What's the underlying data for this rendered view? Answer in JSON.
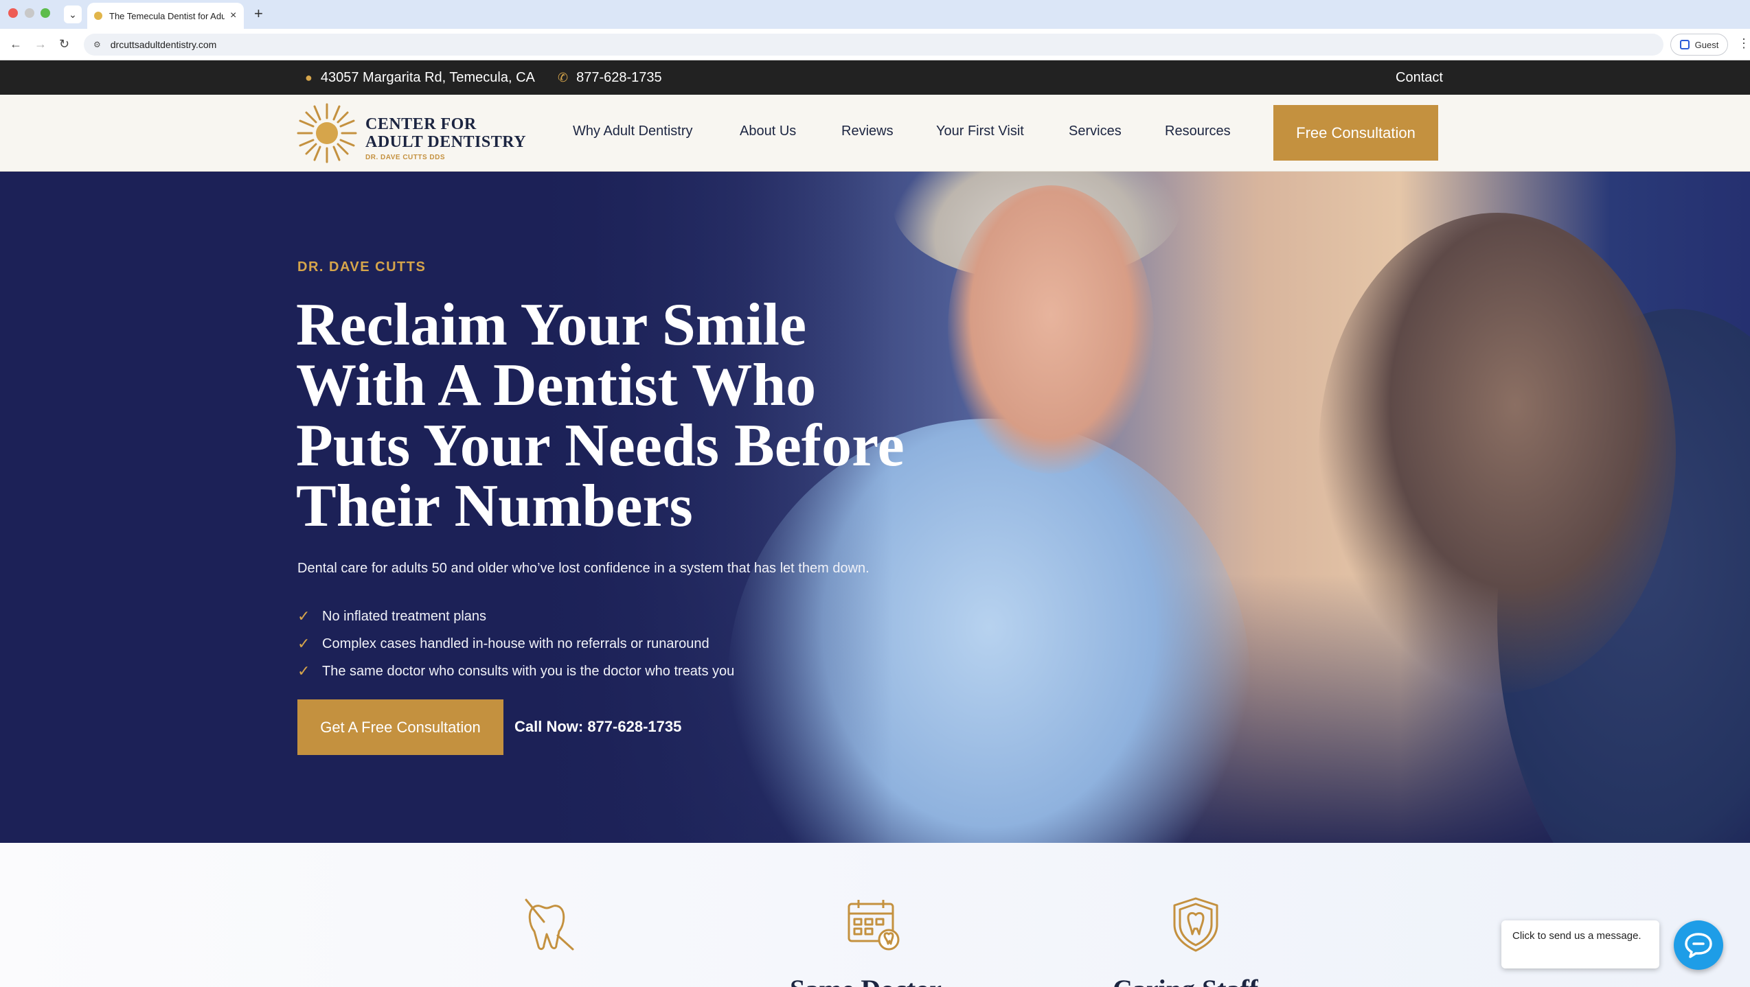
{
  "browser": {
    "tab_title": "The Temecula Dentist for Adu",
    "url": "drcuttsadultdentistry.com",
    "profile_label": "Guest",
    "new_tab": "+",
    "tab_close": "×"
  },
  "topbar": {
    "address": "43057 Margarita Rd, Temecula, CA",
    "phone": "877-628-1735",
    "contact": "Contact"
  },
  "header": {
    "logo_line1": "CENTER FOR",
    "logo_line2": "ADULT DENTISTRY",
    "logo_line3": "DR. DAVE CUTTS DDS",
    "nav": [
      {
        "label": "Why Adult Dentistry"
      },
      {
        "label": "About Us"
      },
      {
        "label": "Reviews"
      },
      {
        "label": "Your First Visit"
      },
      {
        "label": "Services"
      },
      {
        "label": "Resources"
      }
    ],
    "cta": "Free Consultation"
  },
  "hero": {
    "eyebrow": "DR. DAVE CUTTS",
    "headline": "Reclaim Your Smile With A Dentist Who Puts Your Needs Before Their Numbers",
    "subtext": "Dental care for adults 50 and older who’ve lost confidence in a system that has let them down.",
    "bullets": [
      "No inflated treatment plans",
      "Complex cases handled in-house with no referrals or runaround",
      "The same doctor who consults with you is the doctor who treats you"
    ],
    "cta": "Get A Free Consultation",
    "call": "Call Now: 877-628-1735"
  },
  "features": {
    "icons": [
      "tooth-tool-icon",
      "calendar-tooth-icon",
      "shield-tooth-icon"
    ],
    "partial_heading_2": "Same Doctor",
    "partial_heading_3": "Caring Staff"
  },
  "chat": {
    "message": "Click to send us a message."
  },
  "colors": {
    "gold": "#c4913f",
    "navy": "#1c2541",
    "topbar": "#222222",
    "hero_bg": "#1c2157",
    "chat": "#1e9de7"
  }
}
